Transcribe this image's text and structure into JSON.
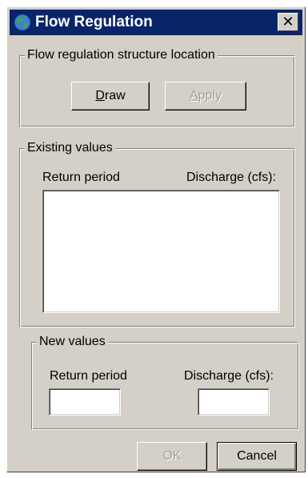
{
  "window": {
    "title": "Flow Regulation",
    "close_glyph": "✕"
  },
  "location_group": {
    "legend": "Flow regulation structure location",
    "draw_button": {
      "mnemonic": "D",
      "rest": "raw"
    },
    "apply_button": {
      "mnemonic": "A",
      "rest": "pply"
    }
  },
  "existing_group": {
    "legend": "Existing values",
    "return_period_label": "Return period",
    "discharge_label": "Discharge (cfs):",
    "rows": []
  },
  "new_group": {
    "legend": "New values",
    "return_period_label": "Return period",
    "discharge_label": "Discharge (cfs):",
    "return_period_value": "",
    "discharge_value": ""
  },
  "footer": {
    "ok_label": "OK",
    "cancel_label": "Cancel"
  },
  "icons": {
    "title_icon": "globe-icon",
    "close_icon": "close-icon"
  }
}
